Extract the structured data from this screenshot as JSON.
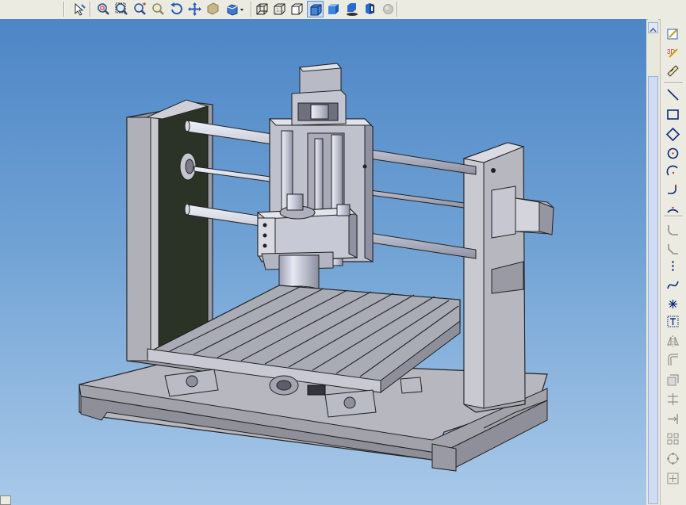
{
  "toolbar": {
    "buttons": [
      {
        "icon": "select-filter-icon"
      },
      {
        "icon": "zoom-to-fit-icon"
      },
      {
        "icon": "zoom-to-area-icon"
      },
      {
        "icon": "zoom-in-out-icon"
      },
      {
        "icon": "zoom-to-selection-icon"
      },
      {
        "icon": "rotate-view-icon"
      },
      {
        "icon": "pan-icon"
      },
      {
        "icon": "section-view-icon"
      },
      {
        "icon": "view-orientation-icon"
      },
      {
        "icon": "wireframe-icon"
      },
      {
        "icon": "hidden-lines-visible-icon"
      },
      {
        "icon": "hidden-lines-removed-icon"
      },
      {
        "icon": "shaded-with-edges-icon",
        "active": true
      },
      {
        "icon": "shaded-icon"
      },
      {
        "icon": "shadows-icon"
      },
      {
        "icon": "perspective-icon"
      },
      {
        "icon": "realview-icon"
      }
    ]
  },
  "sketch_tools": [
    "sketch-icon",
    "3d-sketch-icon",
    "smart-dimension-icon",
    "line-icon",
    "rectangle-icon",
    "polygon-icon",
    "circle-icon",
    "centerpoint-arc-icon",
    "tangent-arc-icon",
    "three-point-arc-icon",
    "fillet-icon",
    "chamfer-icon",
    "centerline-icon",
    "spline-icon",
    "point-icon",
    "text-icon",
    "mirror-icon",
    "offset-entities-icon",
    "convert-entities-icon",
    "trim-icon",
    "extend-icon",
    "linear-pattern-icon",
    "circular-pattern-icon",
    "move-entities-icon"
  ],
  "model": {
    "name": "cnc-router-assembly",
    "colors": {
      "steel": "#c8c8d2",
      "dark-plate": "#2a3326",
      "background-top": "#4d86c6",
      "background-bottom": "#a9c9e9"
    }
  }
}
